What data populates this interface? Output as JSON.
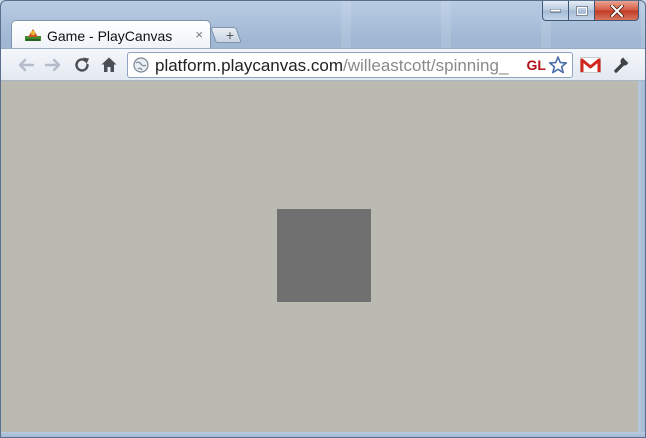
{
  "window": {
    "caption_buttons": [
      "minimize",
      "maximize",
      "close"
    ]
  },
  "tab": {
    "title": "Game - PlayCanvas",
    "close_glyph": "×",
    "favicon": "playcanvas-favicon"
  },
  "new_tab": {
    "glyph": "+"
  },
  "toolbar": {
    "back_icon": "back-arrow-icon",
    "forward_icon": "forward-arrow-icon",
    "reload_icon": "reload-icon",
    "home_icon": "home-icon",
    "wrench_icon": "wrench-icon",
    "gmail_icon": "gmail-icon"
  },
  "omnibox": {
    "domain": "platform.playcanvas.com",
    "path": "/willeastcott/spinning_",
    "extension_label": "GL"
  },
  "colors": {
    "viewport_background": "#bbbab1",
    "cube": "#707070"
  }
}
